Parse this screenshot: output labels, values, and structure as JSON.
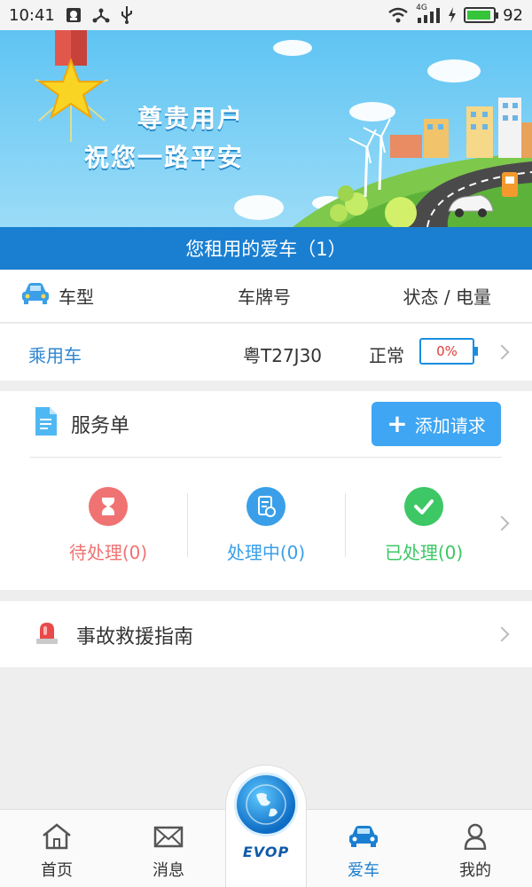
{
  "status_bar": {
    "time": "10:41",
    "network": "4G",
    "battery": "92"
  },
  "banner": {
    "line1": "尊贵用户",
    "line2": "祝您一路平安"
  },
  "title_bar": {
    "text": "您租用的爱车（1）"
  },
  "car_table": {
    "headers": {
      "type": "车型",
      "plate": "车牌号",
      "status": "状态 / 电量"
    },
    "rows": [
      {
        "type": "乘用车",
        "plate": "粤T27J30",
        "state": "正常",
        "charge": "0%"
      }
    ]
  },
  "service": {
    "title": "服务单",
    "add_label": "添加请求",
    "items": [
      {
        "label": "待处理(0)",
        "color": "#f07373"
      },
      {
        "label": "处理中(0)",
        "color": "#3a9fe8"
      },
      {
        "label": "已处理(0)",
        "color": "#3dc765"
      }
    ]
  },
  "rescue": {
    "label": "事故救援指南"
  },
  "tabs": {
    "home": "首页",
    "messages": "消息",
    "center": "EVOP",
    "car": "爱车",
    "mine": "我的"
  },
  "colors": {
    "primary": "#1a7fd1",
    "accent": "#3ea6f3",
    "banner_sky": "#5fc4f3"
  },
  "icons": [
    "qq-icon",
    "share-icon",
    "usb-icon",
    "wifi-icon",
    "signal-icon",
    "charging-icon",
    "medal-icon",
    "car-icon",
    "document-icon",
    "hourglass-icon",
    "processing-icon",
    "check-icon",
    "siren-icon",
    "home-icon",
    "mail-icon",
    "globe-icon",
    "user-icon"
  ]
}
